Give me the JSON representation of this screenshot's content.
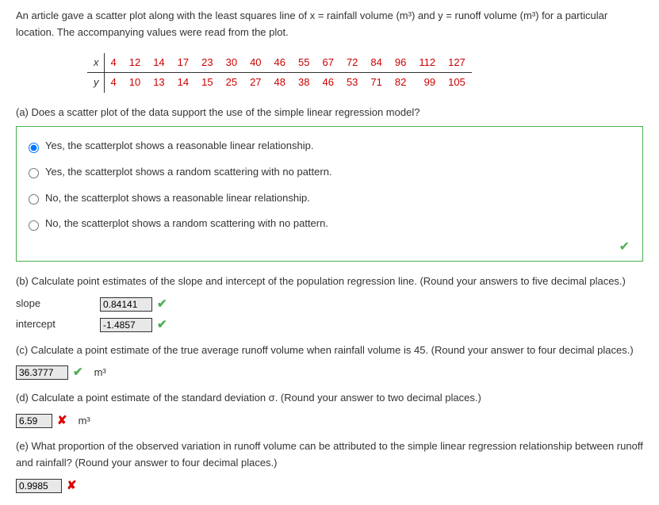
{
  "intro": "An article gave a scatter plot along with the least squares line of x = rainfall volume (m³) and y = runoff volume (m³) for a particular location. The accompanying values were read from the plot.",
  "table": {
    "x_label": "x",
    "y_label": "y",
    "x": [
      "4",
      "12",
      "14",
      "17",
      "23",
      "30",
      "40",
      "46",
      "55",
      "67",
      "72",
      "84",
      "96",
      "112",
      "127"
    ],
    "y": [
      "4",
      "10",
      "13",
      "14",
      "15",
      "25",
      "27",
      "48",
      "38",
      "46",
      "53",
      "71",
      "82",
      "99",
      "105"
    ]
  },
  "partA": {
    "prompt": "(a) Does a scatter plot of the data support the use of the simple linear regression model?",
    "options": [
      "Yes, the scatterplot shows a reasonable linear relationship.",
      "Yes, the scatterplot shows a random scattering with no pattern.",
      "No, the scatterplot shows a reasonable linear relationship.",
      "No, the scatterplot shows a random scattering with no pattern."
    ],
    "selected_index": 0
  },
  "partB": {
    "prompt": "(b) Calculate point estimates of the slope and intercept of the population regression line. (Round your answers to five decimal places.)",
    "slope_label": "slope",
    "intercept_label": "intercept",
    "slope_value": "0.84141",
    "intercept_value": "-1.4857"
  },
  "partC": {
    "prompt": "(c) Calculate a point estimate of the true average runoff volume when rainfall volume is 45. (Round your answer to four decimal places.)",
    "value": "36.3777",
    "unit": "m³"
  },
  "partD": {
    "prompt": "(d) Calculate a point estimate of the standard deviation σ. (Round your answer to two decimal places.)",
    "value": "6.59",
    "unit": "m³"
  },
  "partE": {
    "prompt": "(e) What proportion of the observed variation in runoff volume can be attributed to the simple linear regression relationship between runoff and rainfall? (Round your answer to four decimal places.)",
    "value": "0.9985"
  },
  "icons": {
    "check": "✔",
    "cross": "✘"
  }
}
